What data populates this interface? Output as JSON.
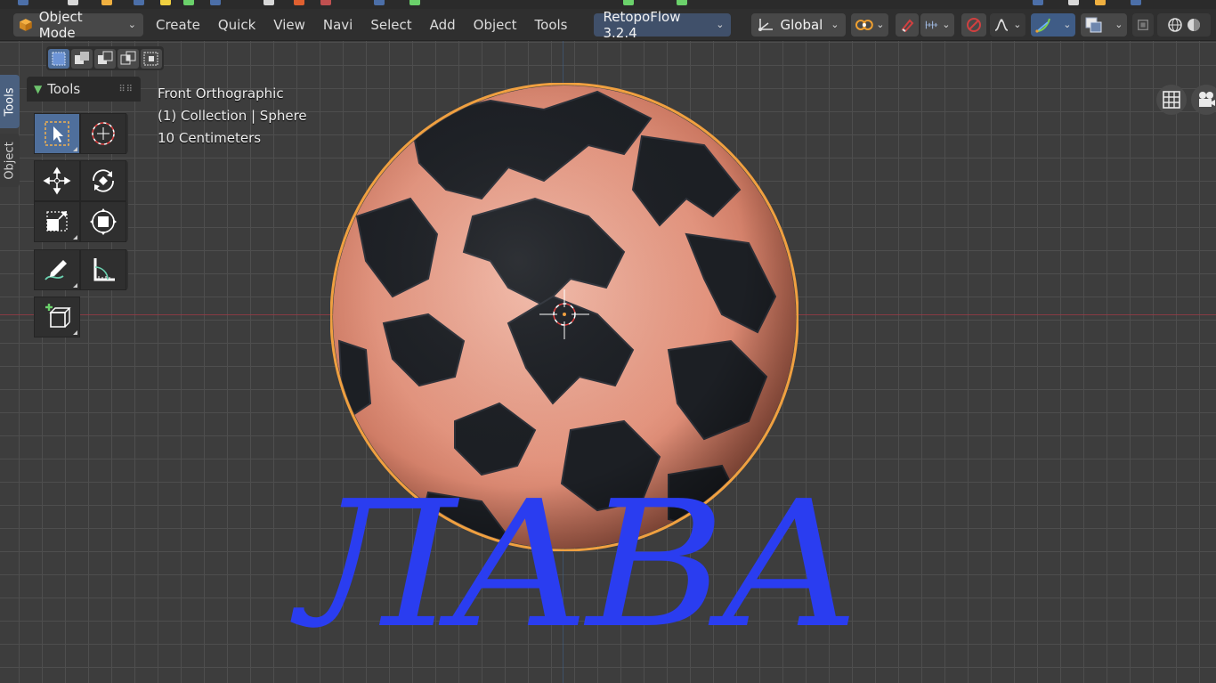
{
  "header": {
    "mode_label": "Object Mode",
    "menu": [
      "Create",
      "Quick",
      "View",
      "Navi",
      "Select",
      "Add",
      "Object",
      "Tools"
    ],
    "addon_label": "RetopoFlow 3.2.4",
    "orientation_label": "Global"
  },
  "side_tabs": [
    "Tools",
    "Object"
  ],
  "tools_panel": {
    "title": "Tools"
  },
  "viewport": {
    "view_name": "Front Orthographic",
    "collection_info": "(1) Collection | Sphere",
    "scale_info": "10 Centimeters"
  },
  "scene_text": "ЛАВА",
  "colors": {
    "accent_blue": "#4f6f9c",
    "retopo_blue": "#40506a",
    "text_object": "#2a3df0",
    "lava": "#e8a08c",
    "rock": "#1c1f24",
    "selection_outline": "#f0a040"
  }
}
